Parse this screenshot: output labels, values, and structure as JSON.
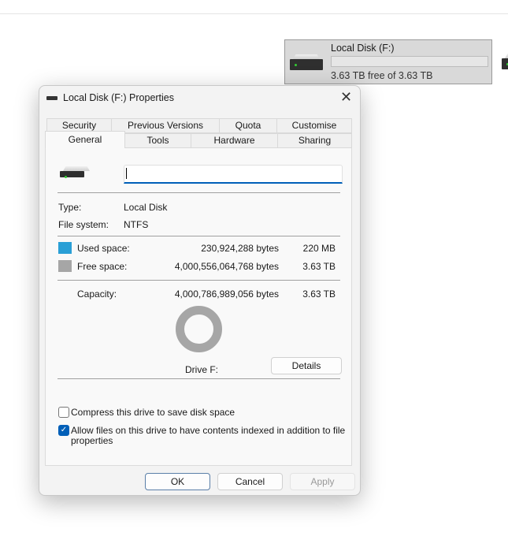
{
  "drive_tile": {
    "name": "Local Disk (F:)",
    "free_text": "3.63 TB free of 3.63 TB",
    "used_fraction": 0.0001
  },
  "dialog": {
    "title": "Local Disk (F:) Properties",
    "tabs_row1": [
      "Security",
      "Previous Versions",
      "Quota",
      "Customise"
    ],
    "tabs_row2": [
      "General",
      "Tools",
      "Hardware",
      "Sharing"
    ],
    "active_tab": "General",
    "label_value": "",
    "type_label": "Type:",
    "type_value": "Local Disk",
    "fs_label": "File system:",
    "fs_value": "NTFS",
    "used_label": "Used space:",
    "used_bytes": "230,924,288 bytes",
    "used_size": "220 MB",
    "free_label": "Free space:",
    "free_bytes": "4,000,556,064,768 bytes",
    "free_size": "3.63 TB",
    "capacity_label": "Capacity:",
    "capacity_bytes": "4,000,786,989,056 bytes",
    "capacity_size": "3.63 TB",
    "drive_caption": "Drive F:",
    "details_button": "Details",
    "compress_label": "Compress this drive to save disk space",
    "compress_checked": false,
    "index_label_1": "Allow files on this drive to have contents indexed in addition to file",
    "index_label_2": "properties",
    "index_checked": true,
    "ok": "OK",
    "cancel": "Cancel",
    "apply": "Apply",
    "colors": {
      "used": "#2a9fd6",
      "free": "#a6a6a6",
      "accent": "#005fb8"
    }
  }
}
